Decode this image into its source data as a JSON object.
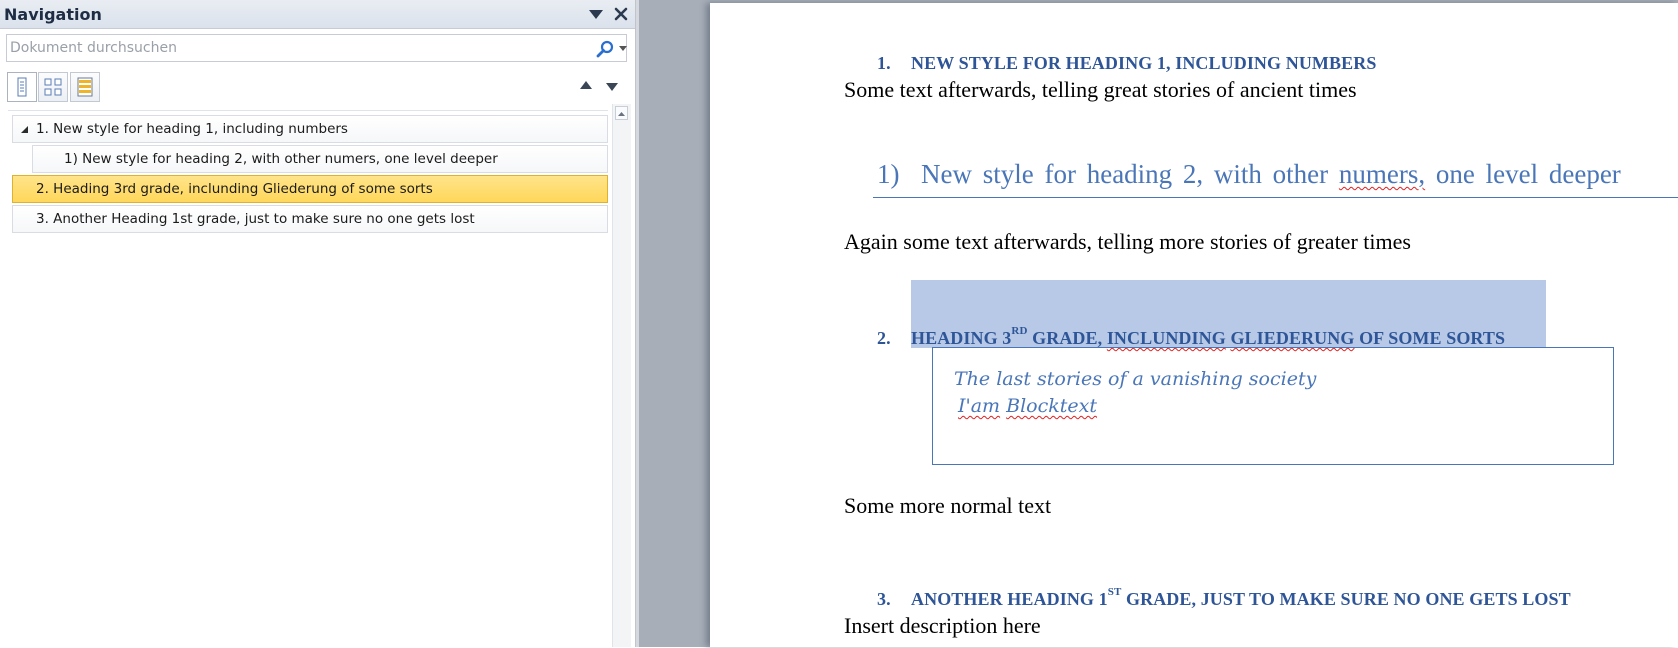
{
  "navigation": {
    "title": "Navigation",
    "search": {
      "placeholder": "Dokument durchsuchen",
      "value": ""
    },
    "tree": [
      {
        "label": "1. New style for heading 1, including numbers",
        "level": 1,
        "expanded": true,
        "selected": false
      },
      {
        "label": "1) New style for heading 2, with other numers, one level deeper",
        "level": 2,
        "selected": false
      },
      {
        "label": "2. Heading 3rd grade, inclunding Gliederung of some sorts",
        "level": 1,
        "selected": true
      },
      {
        "label": "3. Another Heading 1st grade, just to make sure no one gets lost",
        "level": 1,
        "selected": false
      }
    ]
  },
  "document": {
    "heading1_first": {
      "number": "1.",
      "text": "NEW STYLE FOR HEADING 1, INCLUDING NUMBERS"
    },
    "para_1": "Some text afterwards, telling great stories of ancient times",
    "heading2": {
      "number": "1)",
      "text_before": "New style for heading 2, with other ",
      "misspelled": "numers,",
      "text_after": " one level deeper"
    },
    "para_2": "Again some text afterwards, telling more stories of greater times",
    "heading1_second": {
      "number": "2.",
      "text_a": "HEADING 3",
      "sup": "RD",
      "text_b": " GRADE, ",
      "misspelled_1": "INCLUNDING",
      "text_c": " ",
      "misspelled_2": "GLIEDERUNG",
      "text_d": " OF SOME SORTS"
    },
    "blocktext": {
      "line_1": "The last stories of a vanishing society",
      "line_2_part1": "I'am",
      "line_2_part2": "Blocktext"
    },
    "para_3": "Some more normal text",
    "heading1_third": {
      "number": "3.",
      "text_a": "ANOTHER HEADING 1",
      "sup": "ST",
      "text_b": " GRADE, JUST TO MAKE SURE NO ONE GETS LOST"
    },
    "para_4": "Insert description here"
  },
  "colors": {
    "heading": "#2e5597",
    "heading2": "#4a76b8",
    "selection": "#b7c9e6",
    "nav_selected": "#ffd75a"
  }
}
